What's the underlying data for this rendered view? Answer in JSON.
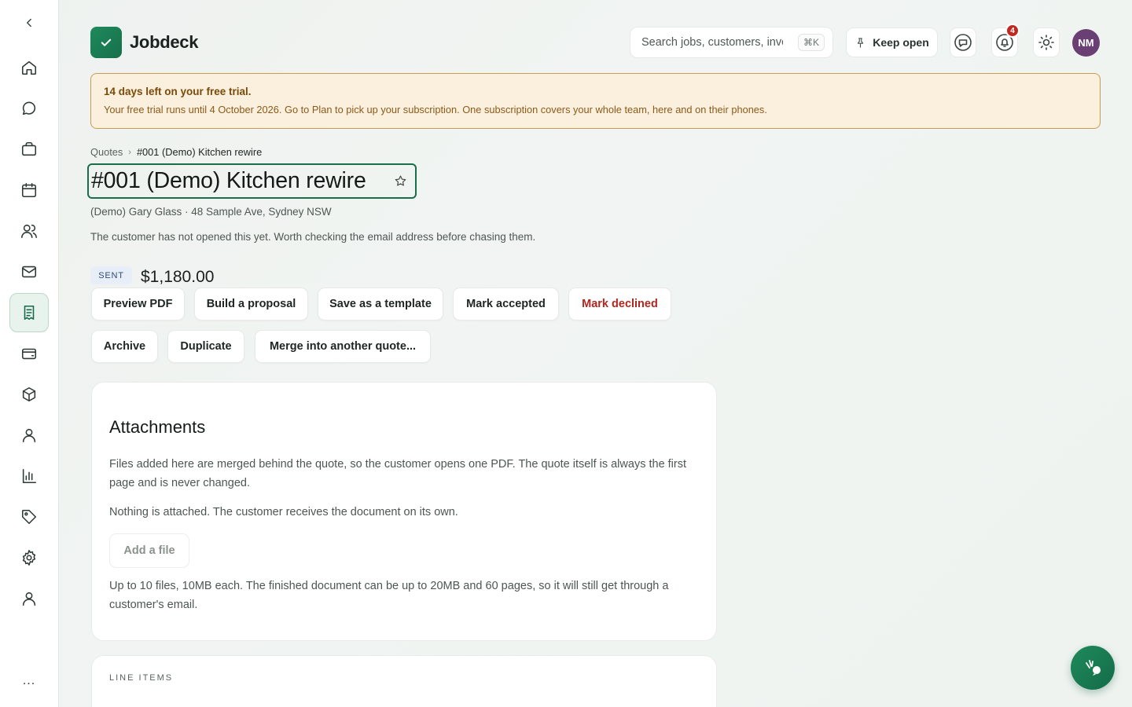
{
  "app": {
    "name": "Jobdeck"
  },
  "header": {
    "search_placeholder": "Search jobs, customers, invoices",
    "search_shortcut": "⌘K",
    "keep_open_label": "Keep open",
    "notifications_count": "4",
    "avatar_initials": "NM"
  },
  "sidebar": {
    "active_item": "quotes",
    "items": [
      "home",
      "messages",
      "jobs",
      "calendar",
      "customers",
      "email",
      "quotes",
      "payments",
      "products",
      "team",
      "reports",
      "tags",
      "settings",
      "profile"
    ],
    "more_label": "..."
  },
  "trial_banner": {
    "title": "14 days left on your free trial.",
    "body": "Your free trial runs until 4 October 2026. Go to Plan to pick up your subscription. One subscription covers your whole team, here and on their phones."
  },
  "breadcrumb": {
    "parent": "Quotes",
    "current": "#001 (Demo) Kitchen rewire"
  },
  "quote": {
    "title": "#001 (Demo) Kitchen rewire",
    "subline": "(Demo) Gary Glass · 48 Sample Ave, Sydney NSW",
    "note": "The customer has not opened this yet. Worth checking the email address before chasing them.",
    "status": "SENT",
    "amount": "$1,180.00"
  },
  "actions": {
    "preview_pdf": "Preview PDF",
    "build_proposal": "Build a proposal",
    "save_template": "Save as a template",
    "mark_accepted": "Mark accepted",
    "mark_declined": "Mark declined",
    "archive": "Archive",
    "duplicate": "Duplicate",
    "merge": "Merge into another quote..."
  },
  "attachments": {
    "title": "Attachments",
    "description": "Files added here are merged behind the quote, so the customer opens one PDF. The quote itself is always the first page and is never changed.",
    "empty_text": "Nothing is attached. The customer receives the document on its own.",
    "add_file_label": "Add a file",
    "limits_text": "Up to 10 files, 10MB each. The finished document can be up to 20MB and 60 pages, so it will still get through a customer's email."
  },
  "line_items": {
    "label": "LINE ITEMS"
  },
  "colors": {
    "brand": "#1a7a52",
    "danger": "#b3261e",
    "trial_bg": "#fbf0dd",
    "trial_border": "#c89d52",
    "avatar": "#6a3f74"
  }
}
